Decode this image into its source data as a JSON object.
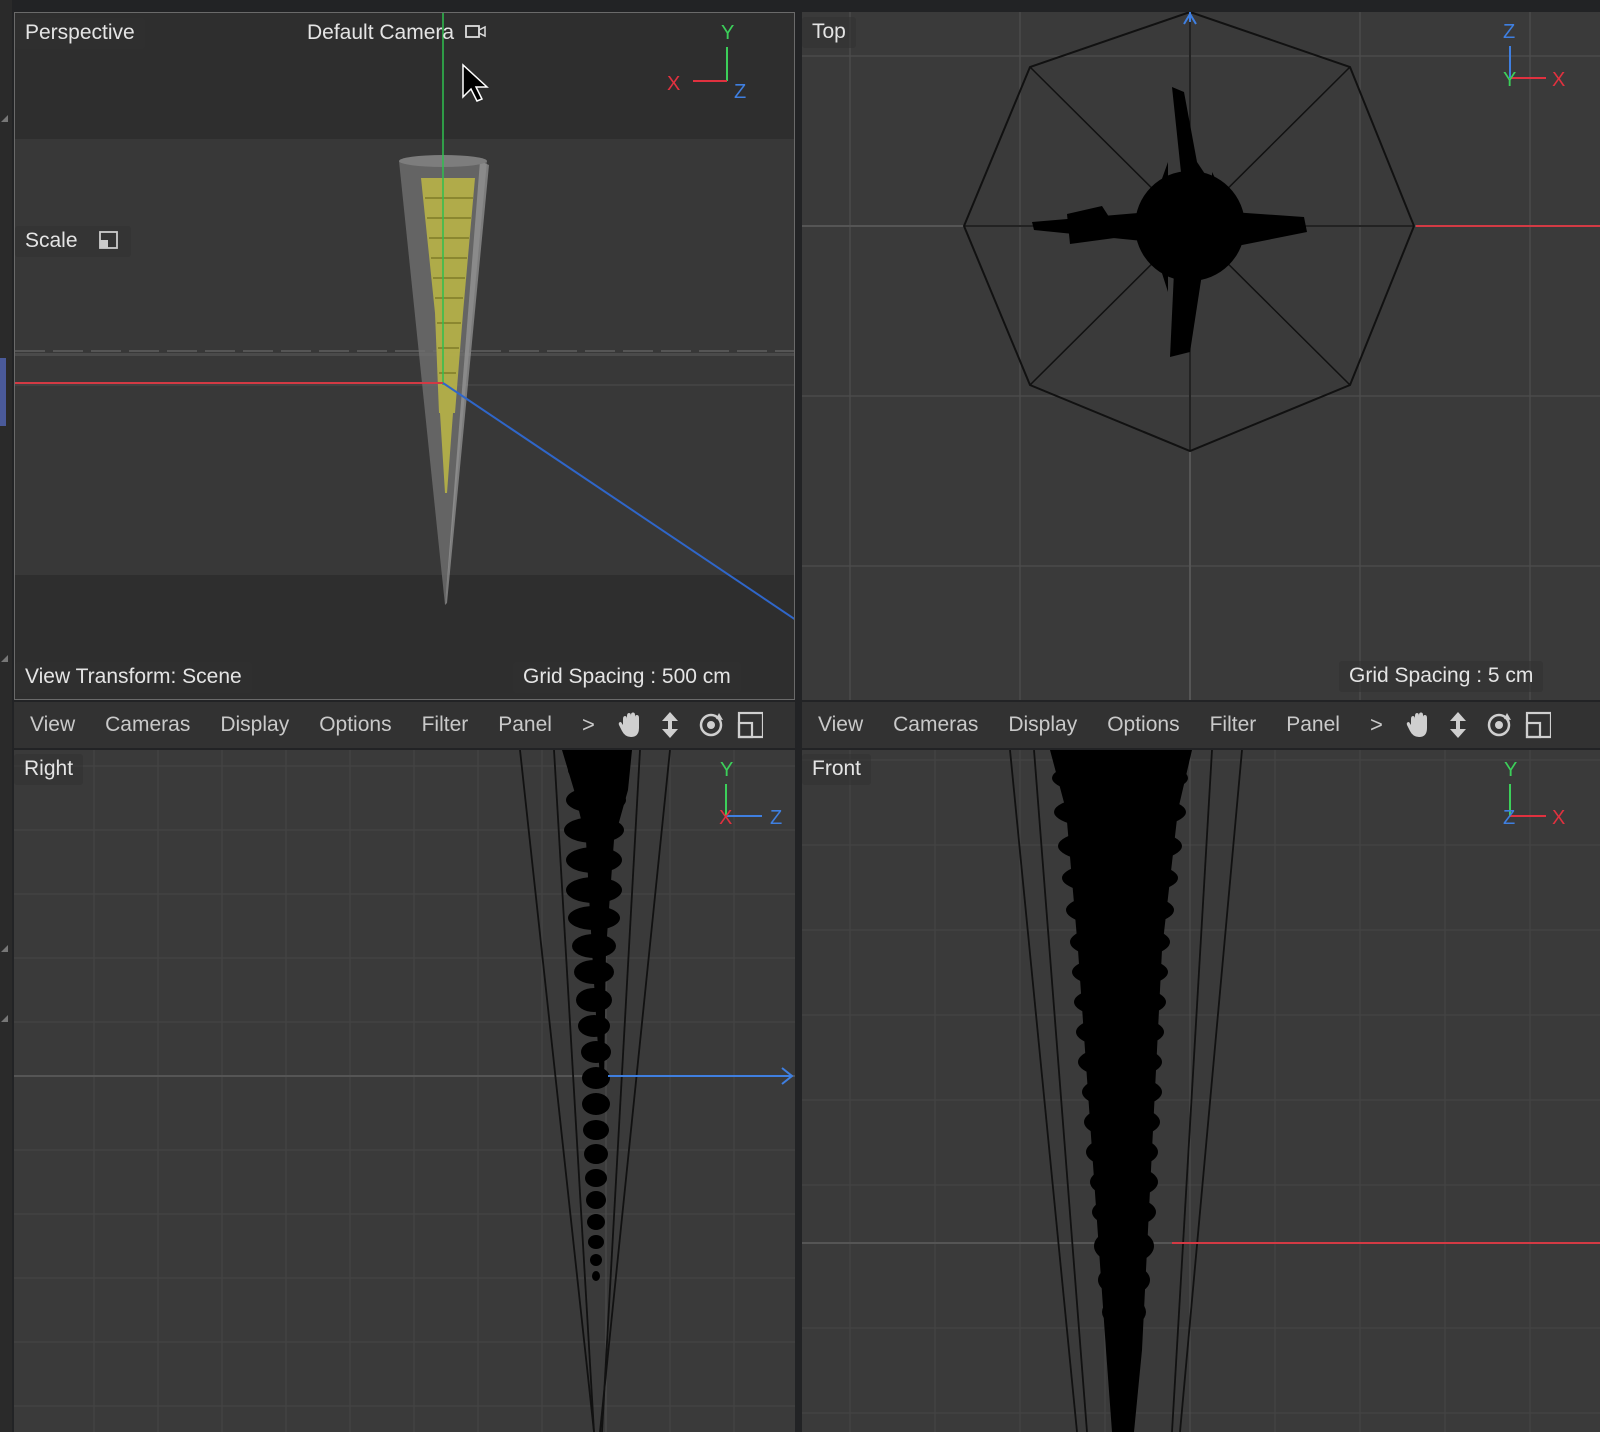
{
  "viewports": {
    "perspective": {
      "name": "Perspective",
      "camera": "Default Camera",
      "hud_scale": "Scale",
      "view_transform": "View Transform: Scene",
      "grid_spacing": "Grid Spacing : 500 cm",
      "axes": {
        "x": "X",
        "y": "Y",
        "z": "Z"
      }
    },
    "top": {
      "name": "Top",
      "grid_spacing": "Grid Spacing : 5 cm",
      "axes": {
        "x": "X",
        "y": "Y",
        "z": "Z"
      }
    },
    "right": {
      "name": "Right",
      "axes": {
        "x": "X",
        "y": "Y",
        "z": "Z"
      }
    },
    "front": {
      "name": "Front",
      "axes": {
        "x": "X",
        "y": "Y",
        "z": "Z"
      }
    }
  },
  "menubar_left": {
    "items": [
      "View",
      "Cameras",
      "Display",
      "Options",
      "Filter",
      "Panel"
    ],
    "more": ">"
  },
  "menubar_right": {
    "items": [
      "View",
      "Cameras",
      "Display",
      "Options",
      "Filter",
      "Panel"
    ],
    "more": ">"
  },
  "colors": {
    "x_axis": "#e0313f",
    "y_axis": "#3ccf5a",
    "z_axis": "#3f7fe0",
    "viewport_bg": "#3a3a3a",
    "selected_model": "#b8b347"
  },
  "toolbar_icons": [
    "pan-hand-icon",
    "move-arrows-icon",
    "orbit-icon",
    "maximize-viewport-icon"
  ]
}
